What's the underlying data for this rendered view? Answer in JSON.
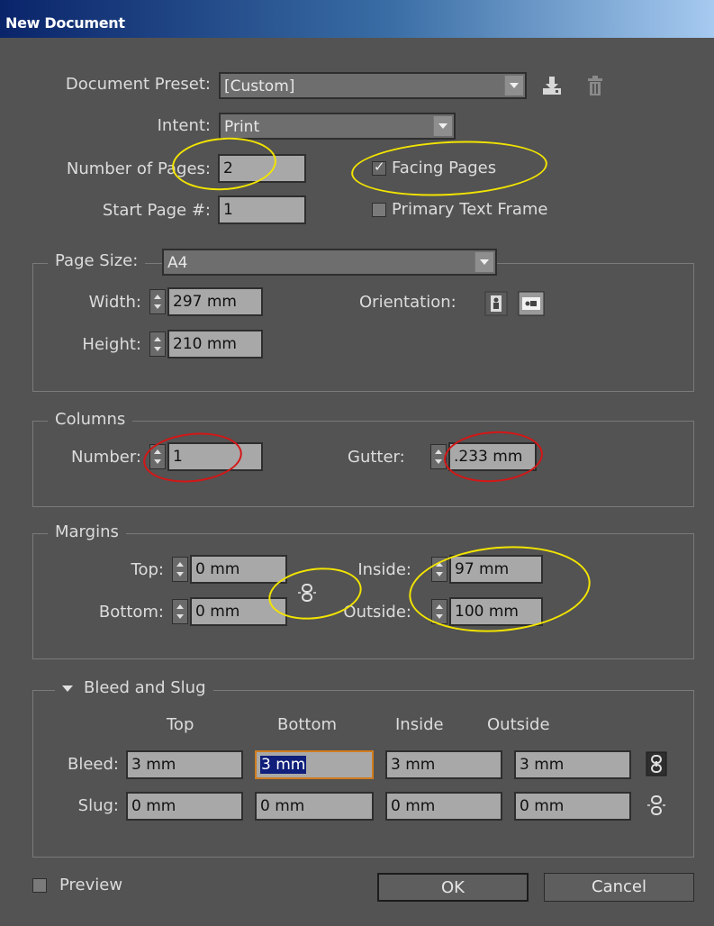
{
  "window": {
    "title": "New Document"
  },
  "top": {
    "preset_label": "Document Preset:",
    "preset_value": "[Custom]",
    "intent_label": "Intent:",
    "intent_value": "Print",
    "pages_label": "Number of Pages:",
    "pages_value": "2",
    "start_label": "Start Page #:",
    "start_value": "1",
    "facing_label": "Facing Pages",
    "facing_checked": true,
    "primary_label": "Primary Text Frame",
    "primary_checked": false,
    "icons": [
      "save-preset-icon",
      "delete-preset-icon"
    ]
  },
  "page_size": {
    "label": "Page Size:",
    "value": "A4",
    "width_label": "Width:",
    "width_value": "297 mm",
    "height_label": "Height:",
    "height_value": "210 mm",
    "orientation_label": "Orientation:",
    "orientation_selected": "landscape"
  },
  "columns": {
    "title": "Columns",
    "number_label": "Number:",
    "number_value": "1",
    "gutter_label": "Gutter:",
    "gutter_value": ".233 mm"
  },
  "margins": {
    "title": "Margins",
    "top_label": "Top:",
    "top_value": "0 mm",
    "bottom_label": "Bottom:",
    "bottom_value": "0 mm",
    "inside_label": "Inside:",
    "inside_value": "97 mm",
    "outside_label": "Outside:",
    "outside_value": "100 mm"
  },
  "bleed_slug": {
    "title": "Bleed and Slug",
    "headers": [
      "Top",
      "Bottom",
      "Inside",
      "Outside"
    ],
    "bleed_label": "Bleed:",
    "bleed_values": [
      "3 mm",
      "3 mm",
      "3 mm",
      "3 mm"
    ],
    "slug_label": "Slug:",
    "slug_values": [
      "0 mm",
      "0 mm",
      "0 mm",
      "0 mm"
    ]
  },
  "footer": {
    "preview_label": "Preview",
    "preview_checked": false,
    "ok_label": "OK",
    "cancel_label": "Cancel"
  },
  "colors": {
    "annotation_yellow": "#f2e400",
    "annotation_red": "#d41616",
    "focus_border": "#d07c1e"
  }
}
